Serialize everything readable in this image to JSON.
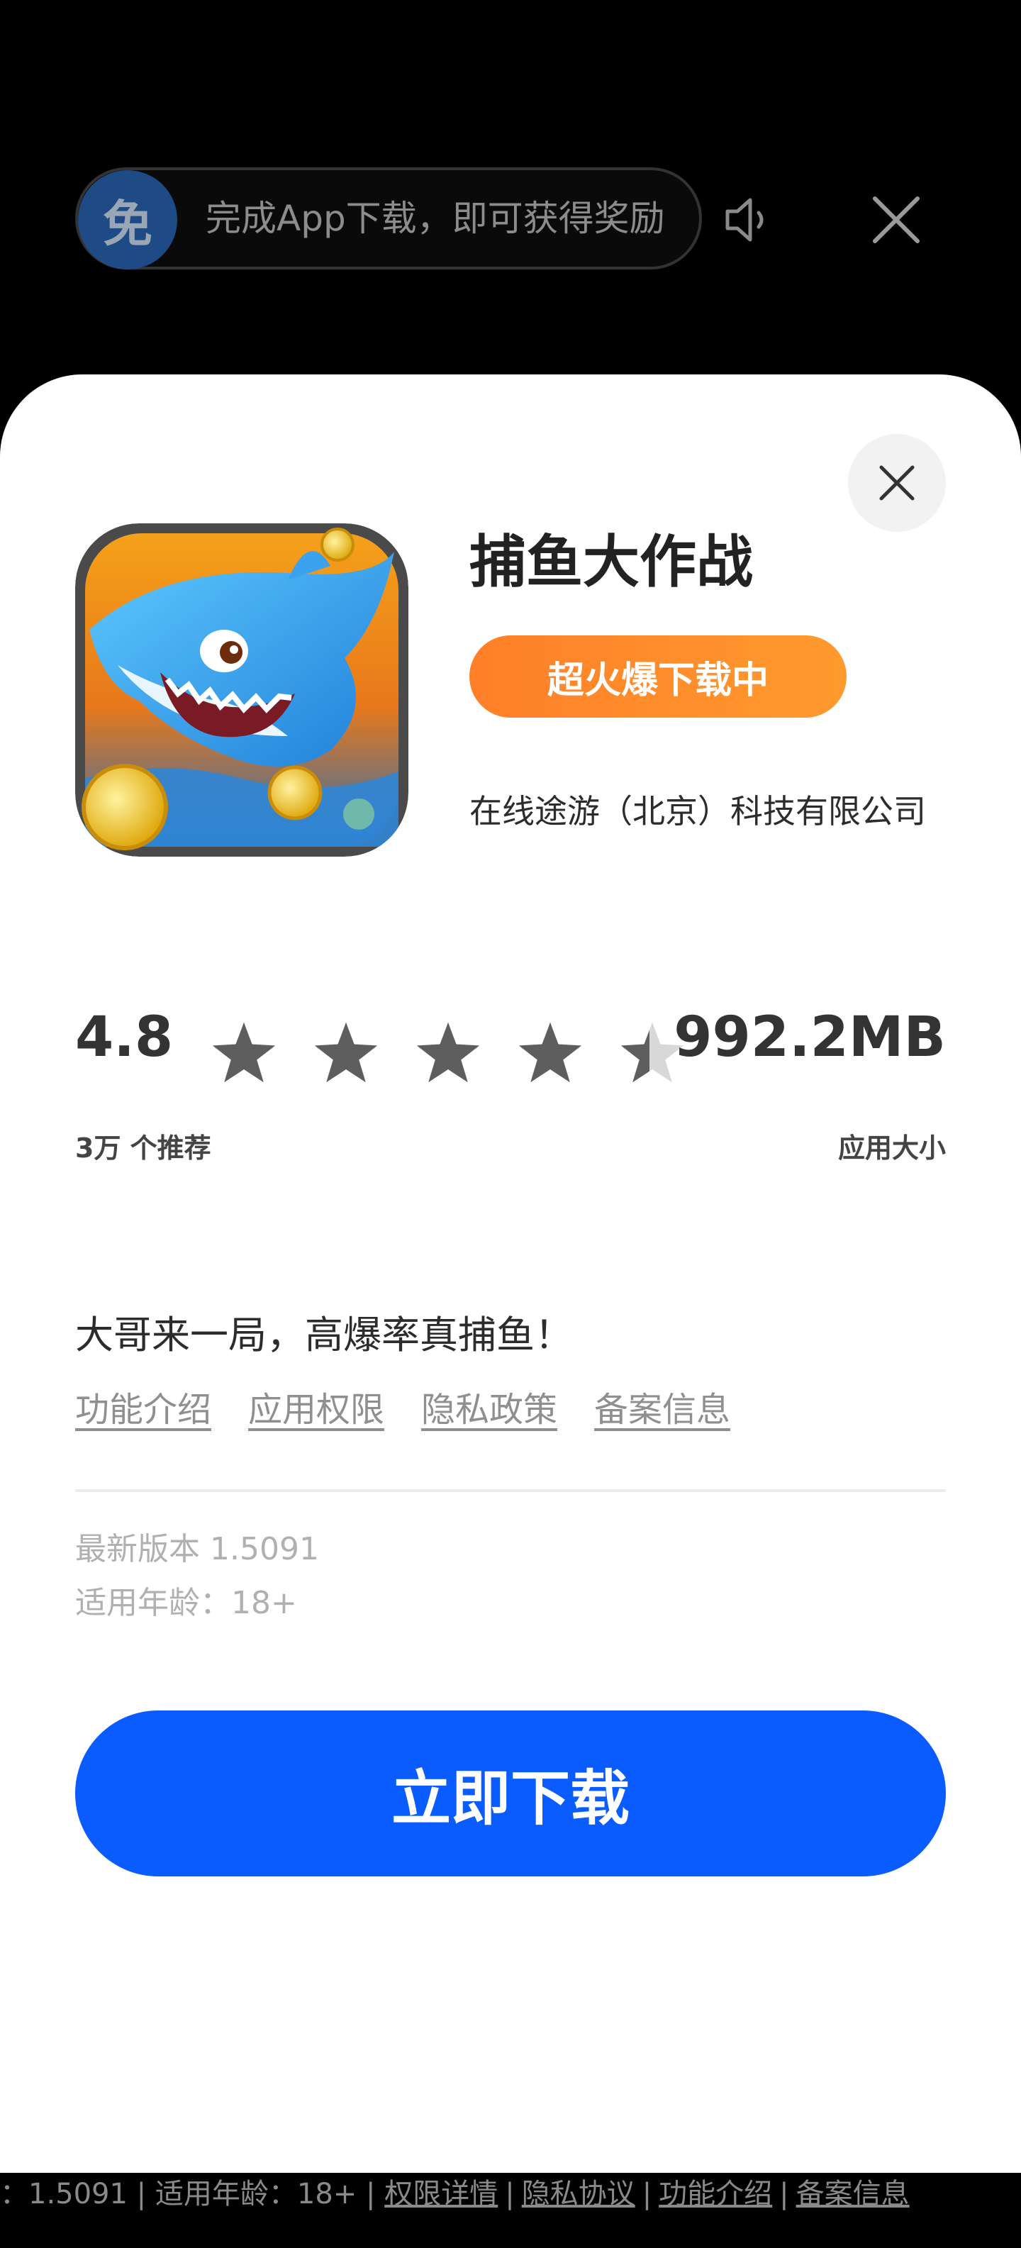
{
  "top_bar": {
    "badge_text": "免",
    "reward_text": "完成App下载，即可获得奖励",
    "speaker_icon": "speaker-icon",
    "close_icon": "close-icon"
  },
  "app": {
    "name": "捕鱼大作战",
    "hot_badge": "超火爆下载中",
    "developer": "在线途游（北京）科技有限公司",
    "rating": "4.8",
    "rating_stars": 4.5,
    "recommend_count": "3万 个推荐",
    "size": "992.2MB",
    "size_label": "应用大小",
    "tagline": "大哥来一局，高爆率真捕鱼！",
    "links": [
      "功能介绍",
      "应用权限",
      "隐私政策",
      "备案信息"
    ],
    "version": "最新版本 1.5091",
    "age": "适用年龄：18+"
  },
  "actions": {
    "download_label": "立即下载"
  },
  "bottom_strip": {
    "prefix": "：1.5091 | 适用年龄：18+ |",
    "links": [
      "权限详情",
      "隐私协议",
      "功能介绍",
      "备案信息"
    ]
  },
  "colors": {
    "accent_blue": "#0a5cff",
    "badge_orange": "#ff8a2b",
    "star_gray": "#5e5e5e"
  }
}
